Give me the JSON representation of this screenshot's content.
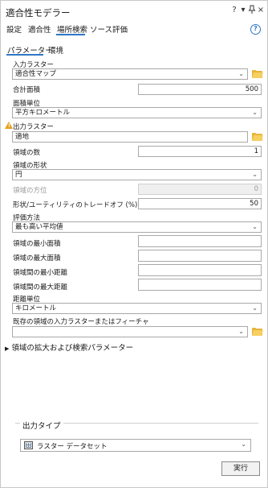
{
  "window": {
    "title": "適合性モデラー",
    "controls": {
      "help": "?",
      "menu": "▾",
      "pin": "",
      "close": "×"
    }
  },
  "tabs": [
    {
      "label": "設定",
      "active": false
    },
    {
      "label": "適合性",
      "active": false
    },
    {
      "label": "場所検索",
      "active": true
    },
    {
      "label": "ソース",
      "active": false
    },
    {
      "label": "評価",
      "active": false
    }
  ],
  "subtabs": [
    {
      "label": "パラメーター",
      "active": true
    },
    {
      "label": "環境",
      "active": false
    }
  ],
  "form": {
    "input_raster": {
      "label": "入力ラスター",
      "value": "適合性マップ"
    },
    "total_area": {
      "label": "合計面積",
      "value": "500"
    },
    "area_unit": {
      "label": "面積単位",
      "value": "平方キロメートル"
    },
    "output_raster": {
      "label": "出力ラスター",
      "value": "適地"
    },
    "num_regions": {
      "label": "領域の数",
      "value": "1"
    },
    "region_shape": {
      "label": "領域の形状",
      "value": "円"
    },
    "region_orientation": {
      "label": "領域の方位",
      "value": "0"
    },
    "shape_tradeoff": {
      "label": "形状/ユーティリティのトレードオフ (%)",
      "value": "50"
    },
    "evaluation_method": {
      "label": "評価方法",
      "value": "最も高い平均値"
    },
    "min_region_area": {
      "label": "領域の最小面積",
      "value": ""
    },
    "max_region_area": {
      "label": "領域の最大面積",
      "value": ""
    },
    "min_distance": {
      "label": "領域間の最小距離",
      "value": ""
    },
    "max_distance": {
      "label": "領域間の最大距離",
      "value": ""
    },
    "distance_unit": {
      "label": "距離単位",
      "value": "キロメートル"
    },
    "existing_regions": {
      "label": "既存の領域の入力ラスターまたはフィーチャ",
      "value": ""
    }
  },
  "expander": {
    "label": "領域の拡大および検索パラメーター"
  },
  "output": {
    "label": "出力タイプ",
    "value": "ラスター データセット"
  },
  "run_button": {
    "label": "実行"
  },
  "colors": {
    "accent": "#2f77c5",
    "warning": "#e4a11b",
    "folder": "#e8b43a"
  }
}
